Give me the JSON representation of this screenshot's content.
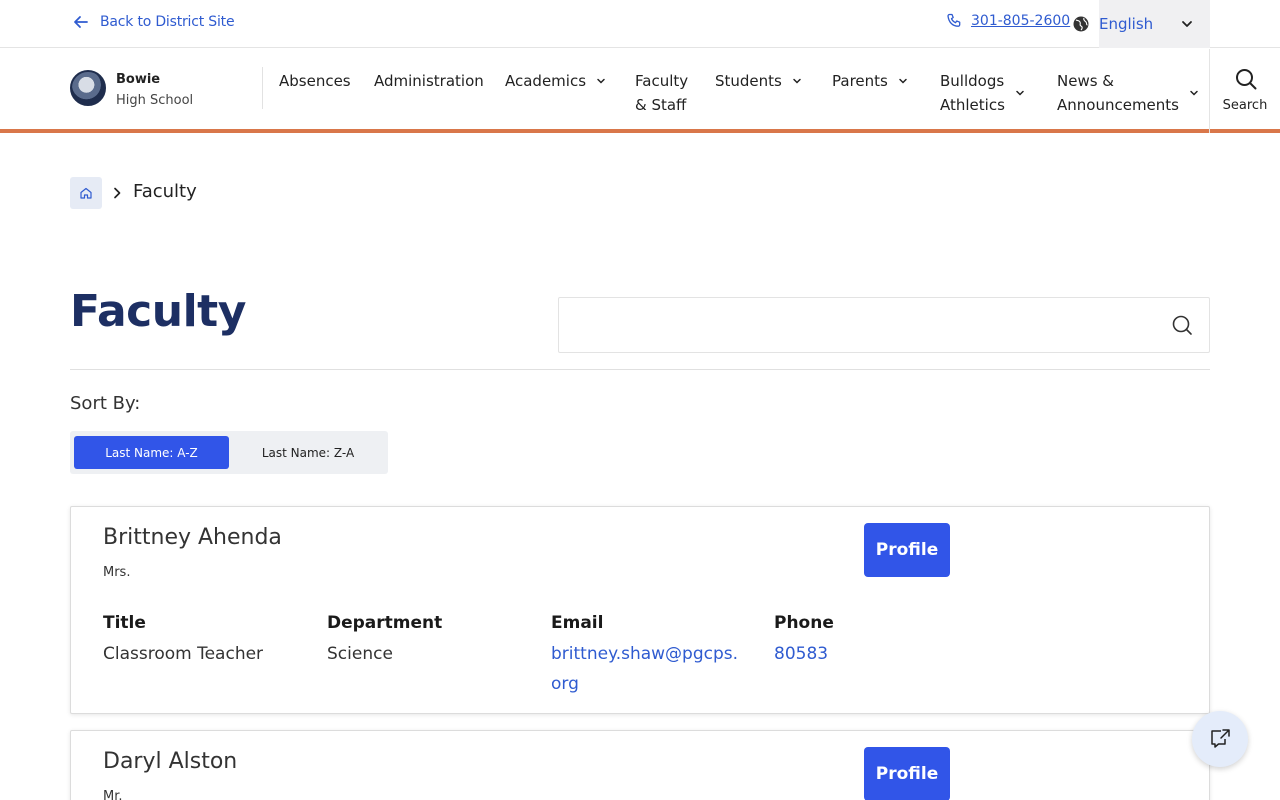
{
  "topbar": {
    "back_label": "Back to District Site",
    "phone": "301-805-2600",
    "language": "English"
  },
  "school": {
    "name_line1": "Bowie",
    "name_line2": "High School"
  },
  "nav": {
    "items": [
      {
        "label": "Absences",
        "has_menu": false
      },
      {
        "label": "Administration",
        "has_menu": false
      },
      {
        "label": "Academics",
        "has_menu": true
      },
      {
        "label": "Faculty\n& Staff",
        "has_menu": false
      },
      {
        "label": "Students",
        "has_menu": true
      },
      {
        "label": "Parents",
        "has_menu": true
      },
      {
        "label": "Bulldogs\nAthletics",
        "has_menu": true
      },
      {
        "label": "News &\nAnnouncements",
        "has_menu": true
      }
    ],
    "search_label": "Search"
  },
  "breadcrumb": {
    "current": "Faculty"
  },
  "page": {
    "title": "Faculty",
    "search_placeholder": ""
  },
  "sort": {
    "label": "Sort By:",
    "options": [
      "Last Name: A-Z",
      "Last Name: Z-A"
    ],
    "active": "Last Name: A-Z"
  },
  "headers": {
    "title": "Title",
    "department": "Department",
    "email": "Email",
    "phone": "Phone"
  },
  "faculty": [
    {
      "name": "Brittney Ahenda",
      "prefix": "Mrs.",
      "profile_label": "Profile",
      "title": "Classroom Teacher",
      "department": "Science",
      "email_line1": "brittney.shaw@pgcps.",
      "email_line2": "org",
      "phone": "80583"
    },
    {
      "name": "Daryl Alston",
      "prefix": "Mr.",
      "profile_label": "Profile"
    }
  ],
  "colors": {
    "accent_blue": "#3155e8",
    "link_blue": "#2f5bd0",
    "title_navy": "#1d2f63",
    "nav_underline": "#d9774a"
  }
}
